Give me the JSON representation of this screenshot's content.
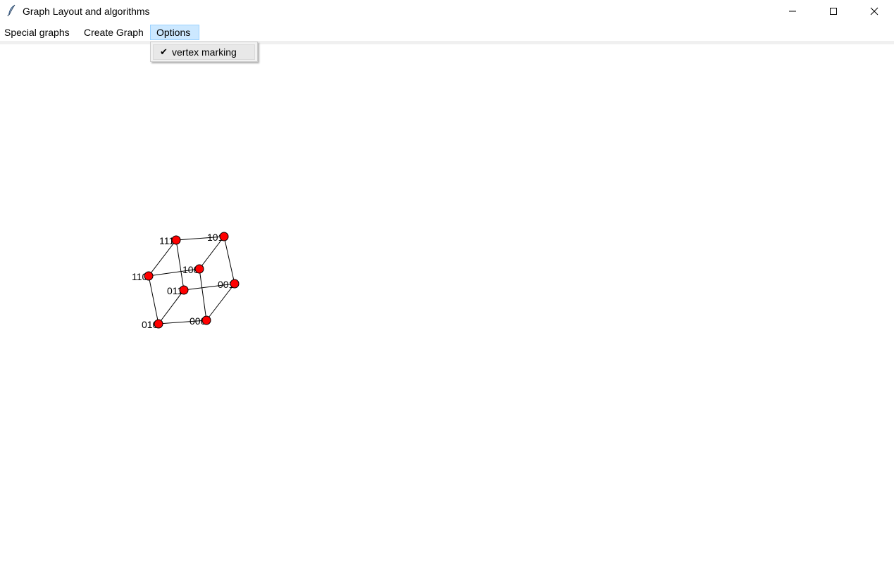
{
  "window": {
    "title": "Graph Layout and algorithms",
    "icon": "feather-icon",
    "controls": [
      "minimize-icon",
      "maximize-icon",
      "close-icon"
    ]
  },
  "menu": {
    "items": [
      {
        "label": "Special graphs"
      },
      {
        "label": "Create Graph"
      },
      {
        "label": "Options"
      }
    ],
    "open_menu": "Options",
    "dropdown": {
      "items": [
        {
          "label": "vertex marking",
          "checked": true,
          "icon": "checkmark-icon"
        }
      ]
    }
  },
  "graph": {
    "vertex_color": "#ff0000",
    "edge_color": "#000000",
    "vertices": [
      {
        "id": "111",
        "label": "111"
      },
      {
        "id": "101",
        "label": "101"
      },
      {
        "id": "110",
        "label": "110"
      },
      {
        "id": "100",
        "label": "100"
      },
      {
        "id": "011",
        "label": "011"
      },
      {
        "id": "001",
        "label": "001"
      },
      {
        "id": "010",
        "label": "010"
      },
      {
        "id": "000",
        "label": "000"
      }
    ],
    "edges": [
      [
        "111",
        "101"
      ],
      [
        "111",
        "110"
      ],
      [
        "111",
        "011"
      ],
      [
        "101",
        "100"
      ],
      [
        "101",
        "001"
      ],
      [
        "110",
        "100"
      ],
      [
        "110",
        "010"
      ],
      [
        "100",
        "000"
      ],
      [
        "011",
        "001"
      ],
      [
        "011",
        "010"
      ],
      [
        "001",
        "000"
      ],
      [
        "010",
        "000"
      ]
    ]
  }
}
